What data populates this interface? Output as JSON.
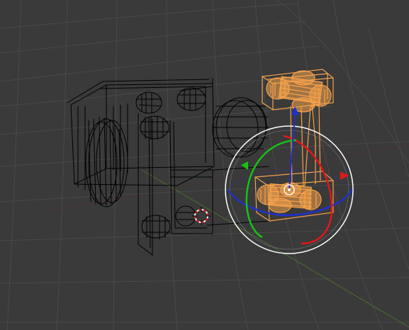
{
  "viewport": {
    "background_color": "#3a3a3a",
    "grid_color": "#4a4a4a",
    "grid_axis_x_color": "#7a3a3a",
    "grid_axis_y_color": "#4f7a2f",
    "wireframe_color": "#000000",
    "selection_color": "#f5a24b",
    "manipulator_ring_color": "#ffffff",
    "manipulator_x_color": "#e01818",
    "manipulator_y_color": "#18c018",
    "manipulator_z_color": "#2030d0",
    "cursor_icon": "3d-cursor-icon",
    "mode": "rotate-manipulator"
  }
}
